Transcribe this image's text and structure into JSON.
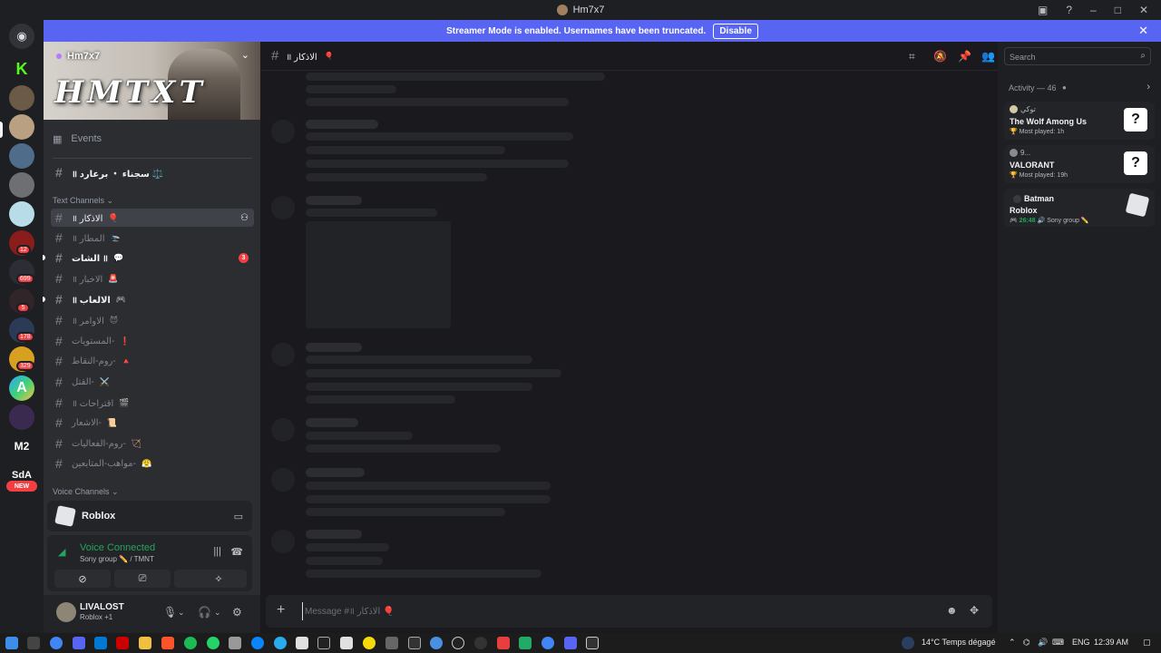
{
  "window": {
    "title": "Hm7x7"
  },
  "banner": {
    "text": "Streamer Mode is enabled. Usernames have been truncated.",
    "disable_label": "Disable"
  },
  "guilds": {
    "badges": [
      "699",
      "5",
      "178",
      "329",
      "12"
    ],
    "m2_label": "M2",
    "sda_label": "SdA",
    "new_label": "NEW",
    "a_label": "A"
  },
  "server": {
    "name": "Hm7x7",
    "banner_art": "HMTXT"
  },
  "sidebar": {
    "events_label": "Events",
    "pinned_channel": "॥ سجناء ・ برعارد ⚖️",
    "text_category": "Text Channels",
    "voice_category": "Voice Channels",
    "channels": [
      {
        "name": "॥ الاذكار",
        "emoji": "🎈"
      },
      {
        "name": "॥ المطار",
        "emoji": "🛬"
      },
      {
        "name": "الشات ॥",
        "emoji": "💬",
        "badge": "3"
      },
      {
        "name": "॥ الاخبار",
        "emoji": "🚨"
      },
      {
        "name": "॥ الالعاب",
        "emoji": "🎮"
      },
      {
        "name": "॥ الاوامر",
        "emoji": "😈"
      },
      {
        "name": "المستويات-",
        "emoji": "❗"
      },
      {
        "name": "روم-النقاط-",
        "emoji": "🔺"
      },
      {
        "name": "القتل-",
        "emoji": "⚔️"
      },
      {
        "name": "॥ اقتراحات",
        "emoji": "🎬"
      },
      {
        "name": "الاشعار-",
        "emoji": "📜"
      },
      {
        "name": "روم-الفعاليات-",
        "emoji": "🏹"
      },
      {
        "name": "مواهب-المتابعين-",
        "emoji": "😤"
      }
    ]
  },
  "activity_panel": {
    "game": "Roblox",
    "voice_status": "Voice Connected",
    "voice_sub": "Sony group ✏️ / TMNT"
  },
  "user": {
    "name": "LIVALOST",
    "status": "Roblox +1"
  },
  "chat": {
    "channel_name": "॥ الاذكار",
    "channel_emoji": "🎈",
    "composer_placeholder": "Message #॥ الاذكار 🎈"
  },
  "search": {
    "placeholder": "Search"
  },
  "activity": {
    "title": "Activity — 46",
    "cards": [
      {
        "user": "توكي",
        "game": "The Wolf Among Us",
        "sub": "Most played: 1h"
      },
      {
        "user": "9...",
        "game": "VALORANT",
        "sub": "Most played: 19h"
      },
      {
        "user": "Batman",
        "game": "Roblox",
        "time": "26:48",
        "sub": "Sony group ✏️"
      }
    ]
  },
  "taskbar": {
    "weather": "14°C  Temps dégagé",
    "lang": "ENG",
    "clock": "12:39 AM"
  }
}
